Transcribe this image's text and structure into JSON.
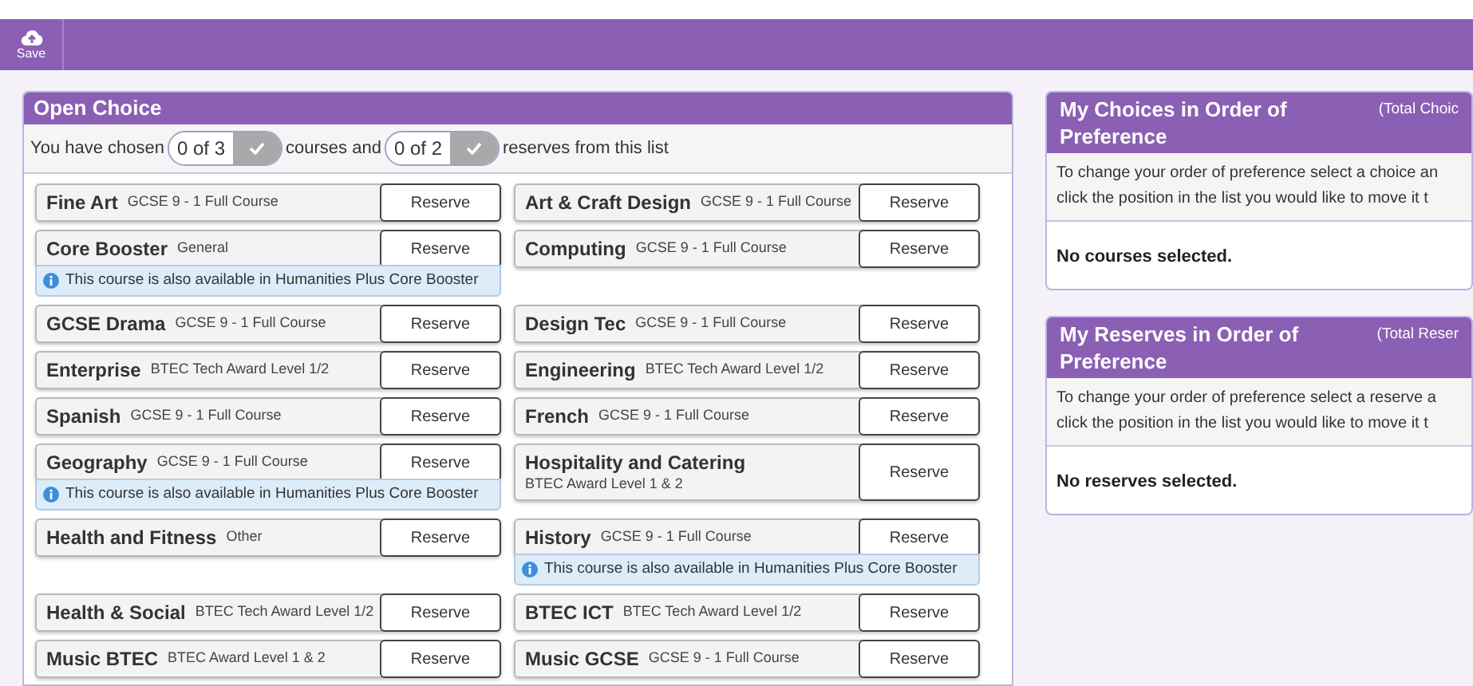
{
  "toolbar": {
    "save_label": "Save"
  },
  "open_choice": {
    "title": "Open Choice",
    "summary": {
      "prefix": "You have chosen",
      "courses_count": "0 of 3",
      "middle": "courses and",
      "reserves_count": "0 of 2",
      "suffix": "reserves from this list"
    },
    "rows": [
      [
        {
          "name": "Fine Art",
          "type": "GCSE 9 - 1 Full Course",
          "button": "Reserve",
          "stacked": false
        },
        {
          "name": "Art & Craft Design",
          "type": "GCSE 9 - 1 Full Course",
          "button": "Reserve",
          "stacked": false
        }
      ],
      [
        {
          "name": "Core Booster",
          "type": "General",
          "button": "Reserve",
          "stacked": false,
          "note": "This course is also available in Humanities Plus Core Booster"
        },
        {
          "name": "Computing",
          "type": "GCSE 9 - 1 Full Course",
          "button": "Reserve",
          "stacked": false
        }
      ],
      [
        {
          "name": "GCSE Drama",
          "type": "GCSE 9 - 1 Full Course",
          "button": "Reserve",
          "stacked": false
        },
        {
          "name": "Design Tec",
          "type": "GCSE 9 - 1 Full Course",
          "button": "Reserve",
          "stacked": false
        }
      ],
      [
        {
          "name": "Enterprise",
          "type": "BTEC Tech Award Level 1/2",
          "button": "Reserve",
          "stacked": false
        },
        {
          "name": "Engineering",
          "type": "BTEC Tech Award Level 1/2",
          "button": "Reserve",
          "stacked": false
        }
      ],
      [
        {
          "name": "Spanish",
          "type": "GCSE 9 - 1 Full Course",
          "button": "Reserve",
          "stacked": false
        },
        {
          "name": "French",
          "type": "GCSE 9 - 1 Full Course",
          "button": "Reserve",
          "stacked": false
        }
      ],
      [
        {
          "name": "Geography",
          "type": "GCSE 9 - 1 Full Course",
          "button": "Reserve",
          "stacked": false,
          "note": "This course is also available in Humanities Plus Core Booster"
        },
        {
          "name": "Hospitality and Catering",
          "type": "BTEC Award Level 1 & 2",
          "button": "Reserve",
          "stacked": true
        }
      ],
      [
        {
          "name": "Health and Fitness",
          "type": "Other",
          "button": "Reserve",
          "stacked": false
        },
        {
          "name": "History",
          "type": "GCSE 9 - 1 Full Course",
          "button": "Reserve",
          "stacked": false,
          "note": "This course is also available in Humanities Plus Core Booster"
        }
      ],
      [
        {
          "name": "Health & Social",
          "type": "BTEC Tech Award Level 1/2",
          "button": "Reserve",
          "stacked": false
        },
        {
          "name": "BTEC ICT",
          "type": "BTEC Tech Award Level 1/2",
          "button": "Reserve",
          "stacked": false
        }
      ],
      [
        {
          "name": "Music BTEC",
          "type": "BTEC Award Level 1 & 2",
          "button": "Reserve",
          "stacked": false
        },
        {
          "name": "Music GCSE",
          "type": "GCSE 9 - 1 Full Course",
          "button": "Reserve",
          "stacked": false
        }
      ]
    ]
  },
  "side_panels": [
    {
      "title": "My Choices in Order of Preference",
      "total": "(Total Choic",
      "instructions": [
        "To change your order of preference select a choice an",
        "click the position in the list you would like to move it t"
      ],
      "empty": "No courses selected."
    },
    {
      "title": "My Reserves in Order of Preference",
      "total": "(Total Reser",
      "instructions": [
        "To change your order of preference select a reserve a",
        "click the position in the list you would like to move it t"
      ],
      "empty": "No reserves selected."
    }
  ]
}
